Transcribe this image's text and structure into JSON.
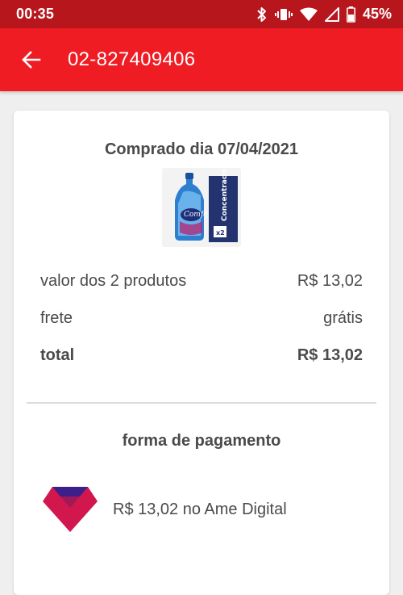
{
  "status_bar": {
    "time": "00:35",
    "battery": "45%",
    "icons": [
      "bluetooth-icon",
      "vibrate-icon",
      "wifi-icon",
      "signal-icon",
      "battery-icon"
    ]
  },
  "app_bar": {
    "title": "02-827409406",
    "back_icon": "arrow-left-icon",
    "color": "#ef1c24"
  },
  "order": {
    "purchase_date_label": "Comprado dia 07/04/2021",
    "product_image": "product-thumbnail-fabric-softener",
    "summary": [
      {
        "label": "valor dos 2 produtos",
        "value": "R$ 13,02",
        "bold": false
      },
      {
        "label": "frete",
        "value": "grátis",
        "bold": false
      },
      {
        "label": "total",
        "value": "R$ 13,02",
        "bold": true
      }
    ]
  },
  "payment": {
    "title": "forma de pagamento",
    "method_icon": "ame-digital-logo",
    "method_text": "R$ 13,02 no Ame Digital"
  },
  "colors": {
    "status_bar": "#b8161d",
    "app_bar": "#ef1c24",
    "background": "#efefef",
    "text": "#4a4a4a"
  }
}
